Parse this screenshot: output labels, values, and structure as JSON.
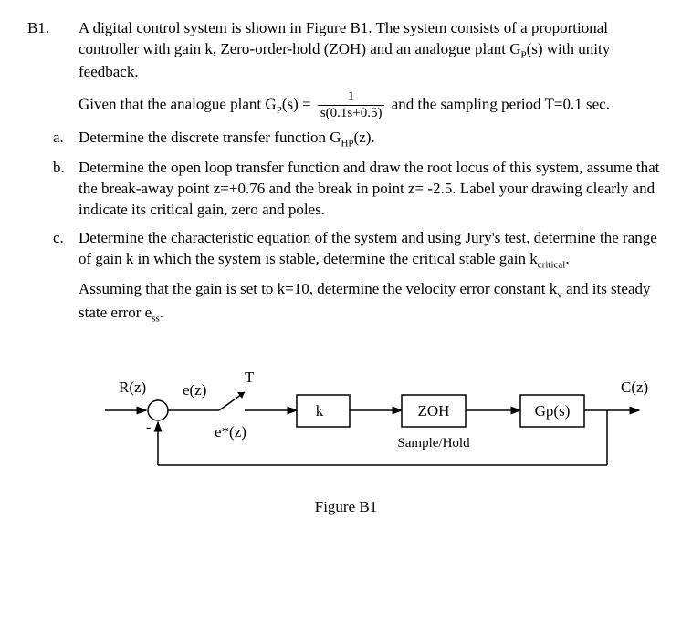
{
  "question_label": "B1.",
  "intro": {
    "p1": "A digital control system is shown in Figure B1. The system consists of a proportional controller with gain k, Zero-order-hold (ZOH) and an analogue plant G",
    "p1_sub": "P",
    "p1_tail": "(s) with unity feedback.",
    "p2_lead": "Given that the analogue plant G",
    "p2_sub": "P",
    "p2_mid": "(s) = ",
    "frac_num": "1",
    "frac_den": "s(0.1s+0.5)",
    "p2_tail": " and the sampling period T=0.1 sec."
  },
  "parts": {
    "a": {
      "label": "a.",
      "text_lead": "Determine the discrete transfer function G",
      "sub": "HP",
      "text_tail": "(z)."
    },
    "b": {
      "label": "b.",
      "text": "Determine the open loop transfer function and draw the root locus of this system, assume that the break-away point z=+0.76 and the break in point z= -2.5. Label your drawing clearly and indicate its critical gain, zero and poles."
    },
    "c": {
      "label": "c.",
      "text1": "Determine the characteristic equation of the system and using Jury's test, determine the range of gain k in which the system is stable, determine the critical stable gain k",
      "text1_sub": "critical",
      "text1_tail": ".",
      "text2_lead": "Assuming that the gain is set to k=10, determine the velocity error constant k",
      "text2_sub1": "v",
      "text2_mid": " and its steady state error e",
      "text2_sub2": "ss",
      "text2_tail": "."
    }
  },
  "figure": {
    "R": "R(z)",
    "e": "e(z)",
    "estar": "e*(z)",
    "T": "T",
    "k": "k",
    "zoh": "ZOH",
    "sample_hold": "Sample/Hold",
    "gp": "Gp(s)",
    "C": "C(z)",
    "minus": "-",
    "caption": "Figure B1"
  }
}
